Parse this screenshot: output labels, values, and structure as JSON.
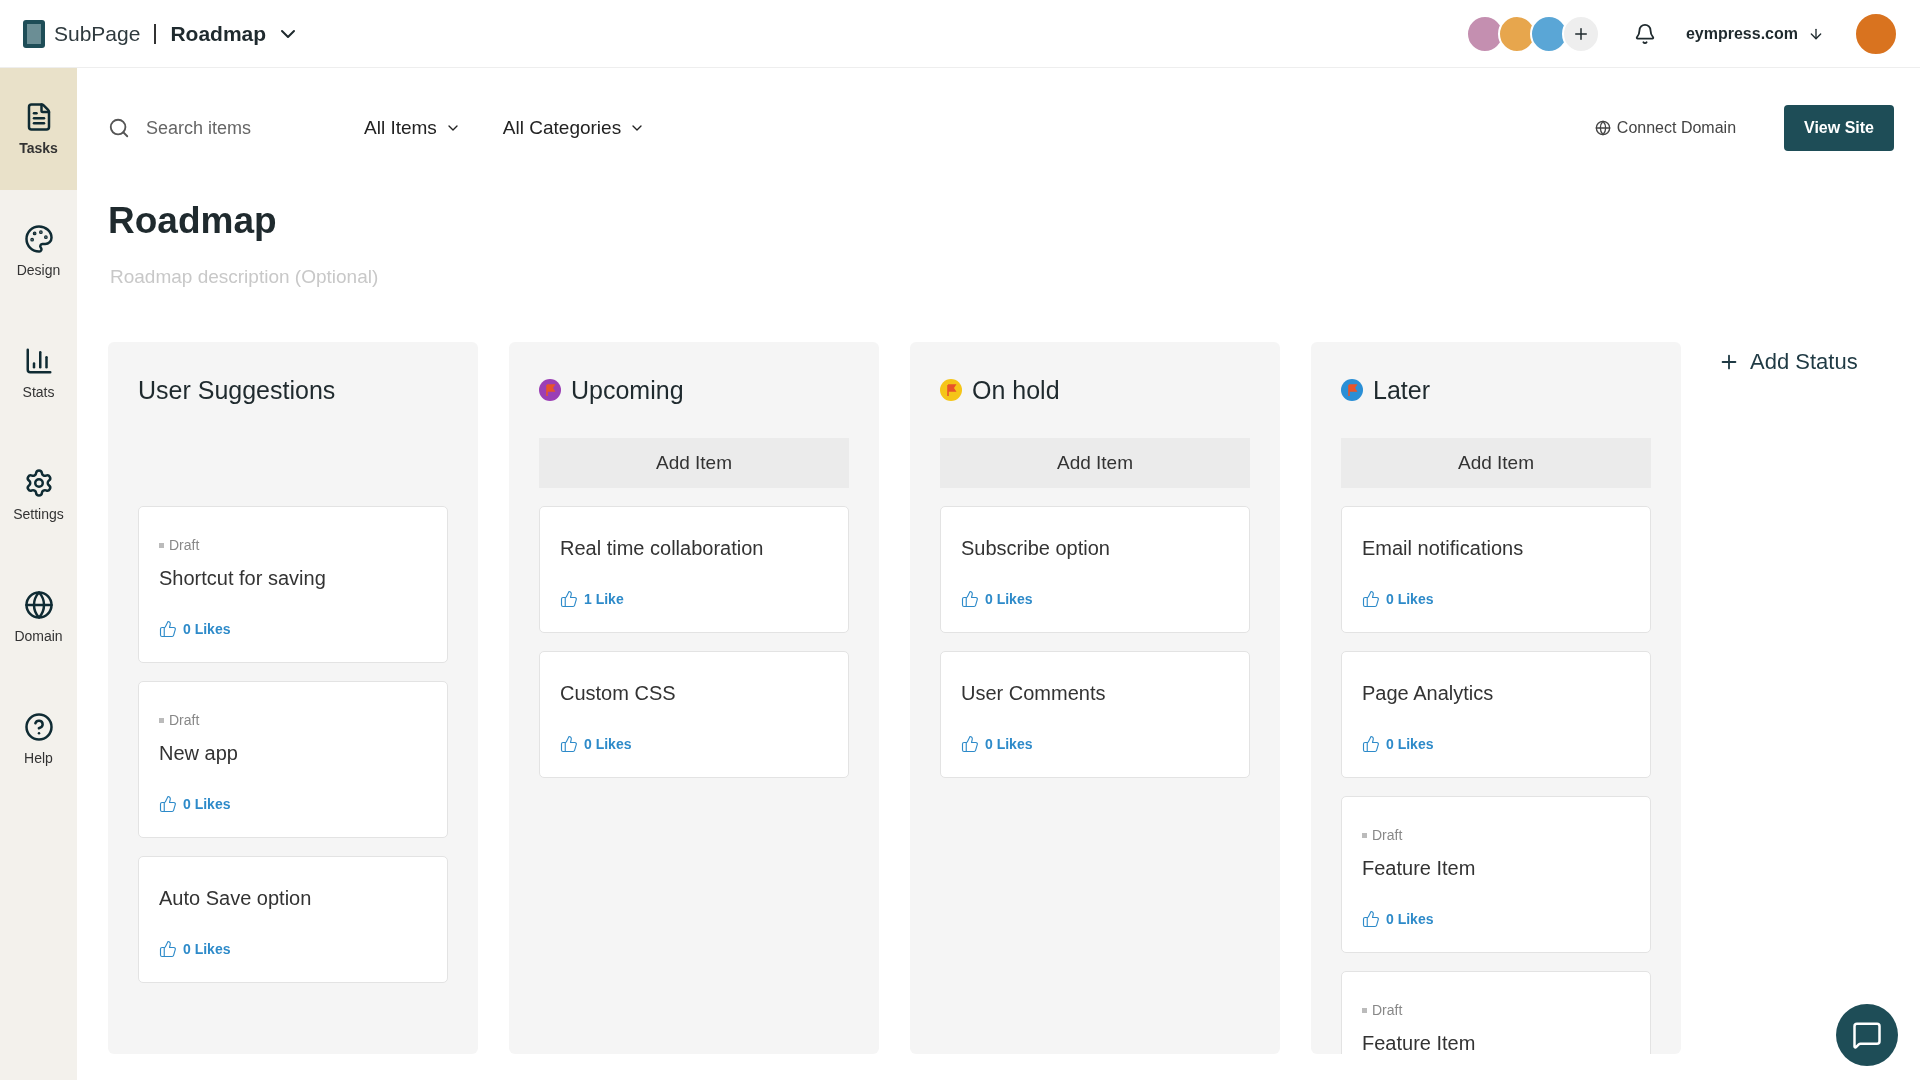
{
  "header": {
    "logo": "SubPage",
    "page_title": "Roadmap",
    "account": "eympress.com"
  },
  "sidebar": {
    "items": [
      {
        "label": "Tasks",
        "selected": true
      },
      {
        "label": "Design",
        "selected": false
      },
      {
        "label": "Stats",
        "selected": false
      },
      {
        "label": "Settings",
        "selected": false
      },
      {
        "label": "Domain",
        "selected": false
      },
      {
        "label": "Help",
        "selected": false
      }
    ]
  },
  "toolbar": {
    "search": {
      "placeholder": "Search items"
    },
    "filters": [
      "All Items",
      "All Categories"
    ],
    "connect_domain": "Connect Domain",
    "view_site": "View Site"
  },
  "roadmap": {
    "title": "Roadmap",
    "description": {
      "placeholder": "Roadmap description (Optional)"
    }
  },
  "add_status": "Add Status",
  "columns": [
    {
      "title": "User Suggestions",
      "cards": [
        {
          "status": "Draft",
          "title": "Shortcut for saving",
          "likes": "0 Likes"
        },
        {
          "status": "Draft",
          "title": "New app",
          "likes": "0 Likes"
        },
        {
          "title": "Auto Save option",
          "likes": "0 Likes"
        }
      ]
    },
    {
      "title": "Upcoming",
      "color": "#9b3fb5",
      "add_item": "Add Item",
      "cards": [
        {
          "title": "Real time collaboration",
          "likes": "1 Like"
        },
        {
          "title": "Custom CSS",
          "likes": "0 Likes"
        }
      ]
    },
    {
      "title": "On hold",
      "color": "#f5c518",
      "add_item": "Add Item",
      "cards": [
        {
          "title": "Subscribe option",
          "likes": "0 Likes"
        },
        {
          "title": "User Comments",
          "likes": "0 Likes"
        }
      ]
    },
    {
      "title": "Later",
      "color": "#2a8fd6",
      "add_item": "Add Item",
      "cards": [
        {
          "title": "Email notifications",
          "likes": "0 Likes"
        },
        {
          "title": "Page Analytics",
          "likes": "0 Likes"
        },
        {
          "status": "Draft",
          "title": "Feature Item",
          "likes": "0 Likes"
        },
        {
          "status": "Draft",
          "title": "Feature Item"
        }
      ]
    }
  ]
}
